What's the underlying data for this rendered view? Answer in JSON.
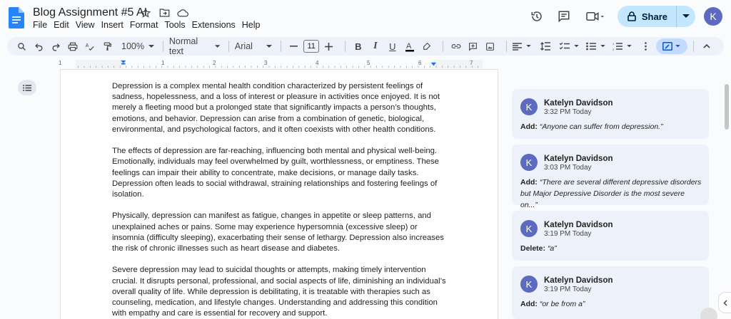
{
  "app": {
    "title": "Blog Assignment #5 AI",
    "menu": [
      "File",
      "Edit",
      "View",
      "Insert",
      "Format",
      "Tools",
      "Extensions",
      "Help"
    ],
    "share_label": "Share",
    "avatar_initial": "K"
  },
  "toolbar": {
    "zoom": "100%",
    "style": "Normal text",
    "font": "Arial",
    "font_size": "11"
  },
  "ruler": {
    "numbers": [
      "1",
      "1",
      "2",
      "3",
      "4",
      "5",
      "6",
      "7"
    ]
  },
  "document": {
    "paragraphs": [
      "Depression is a complex mental health condition characterized by persistent feelings of sadness, hopelessness, and a loss of interest or pleasure in activities once enjoyed. It is not merely a fleeting mood but a prolonged state that significantly impacts a person’s thoughts, emotions, and behavior. Depression can arise from a combination of genetic, biological, environmental, and psychological factors, and it often coexists with other health conditions.",
      "The effects of depression are far-reaching, influencing both mental and physical well-being. Emotionally, individuals may feel overwhelmed by guilt, worthlessness, or emptiness. These feelings can impair their ability to concentrate, make decisions, or manage daily tasks. Depression often leads to social withdrawal, straining relationships and fostering feelings of isolation.",
      "Physically, depression can manifest as fatigue, changes in appetite or sleep patterns, and unexplained aches or pains. Some may experience hypersomnia (excessive sleep) or insomnia (difficulty sleeping), exacerbating their sense of lethargy. Depression also increases the risk of chronic illnesses such as heart disease and diabetes.",
      "Severe depression may lead to suicidal thoughts or attempts, making timely intervention crucial. It disrupts personal, professional, and social aspects of life, diminishing an individual’s overall quality of life. While depression is debilitating, it is treatable with therapies such as counseling, medication, and lifestyle changes. Understanding and addressing this condition with empathy and care is essential for recovery and support."
    ]
  },
  "comments": [
    {
      "initial": "K",
      "name": "Katelyn Davidson",
      "time": "3:32 PM Today",
      "action": "Add:",
      "text": "“Anyone can suffer from depression.”"
    },
    {
      "initial": "K",
      "name": "Katelyn Davidson",
      "time": "3:03 PM Today",
      "action": "Add:",
      "text": "“There are several different depressive disorders",
      "text2": "but Major Depressive Disorder is the most severe on...”"
    },
    {
      "initial": "K",
      "name": "Katelyn Davidson",
      "time": "3:19 PM Today",
      "action": "Delete:",
      "text": "“a”"
    },
    {
      "initial": "K",
      "name": "Katelyn Davidson",
      "time": "3:19 PM Today",
      "action": "Add:",
      "text": "“or be from a”"
    }
  ],
  "colors": {
    "accent": "#c2e7ff",
    "avatar": "#5c6bc0",
    "comment_bg": "#edf2fa"
  }
}
